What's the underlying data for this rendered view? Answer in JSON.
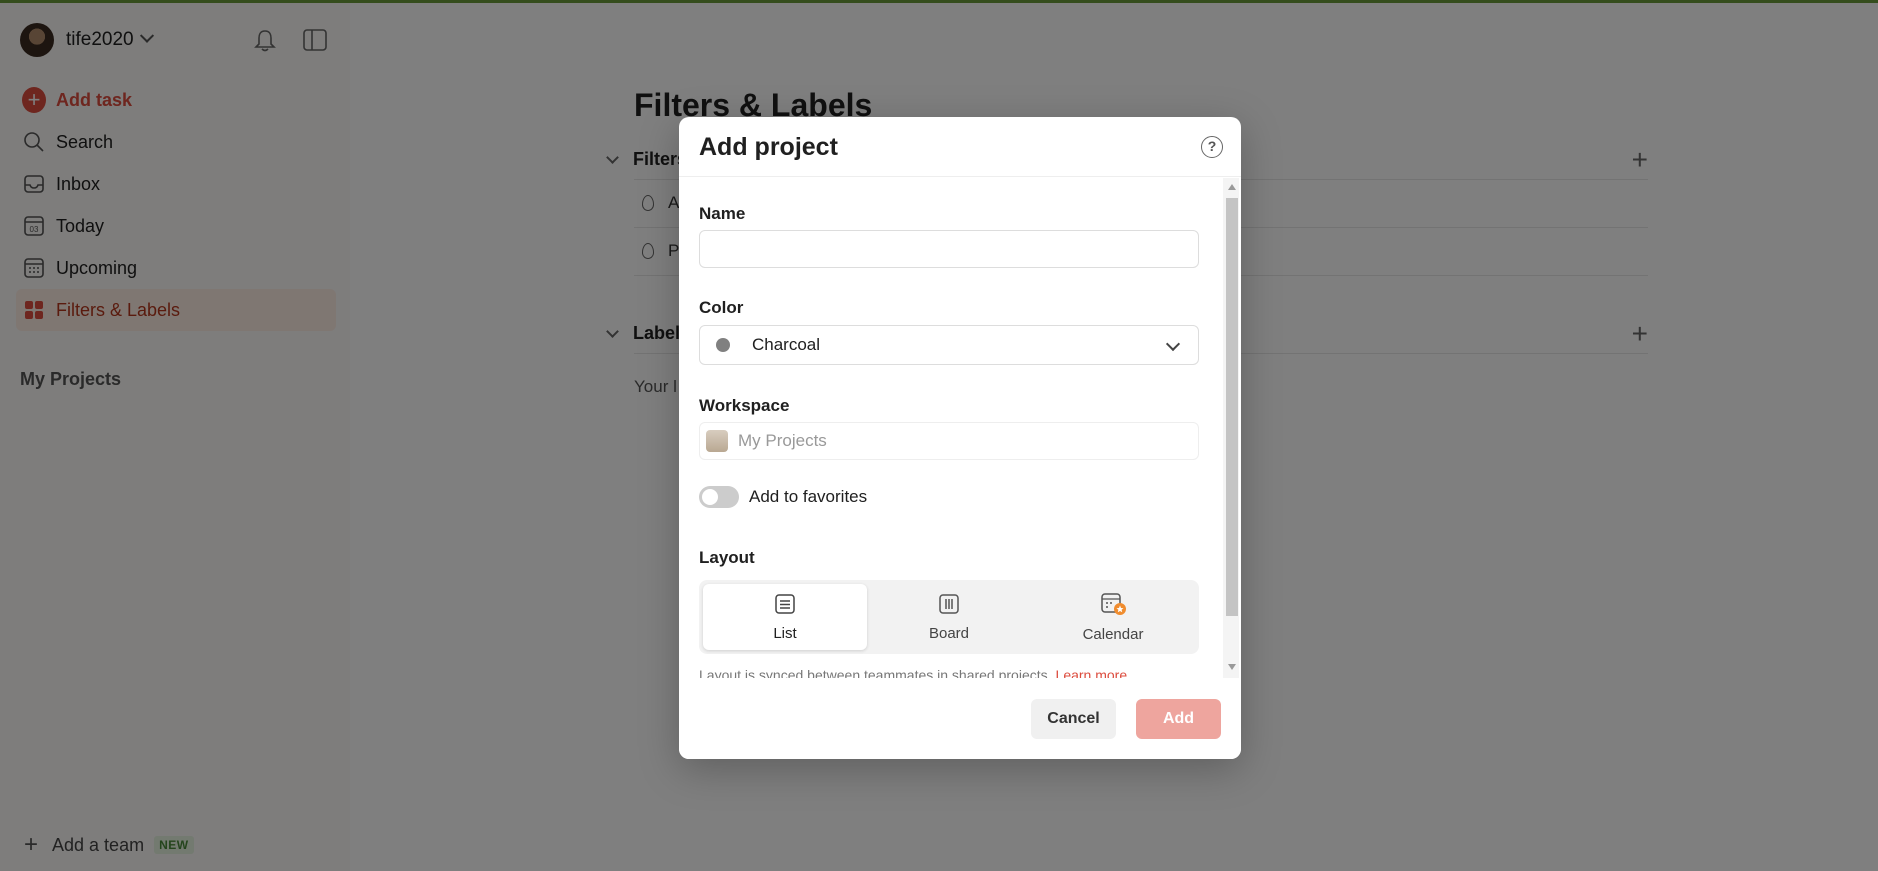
{
  "sidebar": {
    "username": "tife2020",
    "nav": [
      {
        "label": "Add task",
        "icon": "plus-circle-icon"
      },
      {
        "label": "Search",
        "icon": "search-icon"
      },
      {
        "label": "Inbox",
        "icon": "inbox-icon"
      },
      {
        "label": "Today",
        "icon": "calendar-today-icon",
        "day": "03"
      },
      {
        "label": "Upcoming",
        "icon": "calendar-grid-icon"
      },
      {
        "label": "Filters & Labels",
        "icon": "filters-grid-icon"
      }
    ],
    "my_projects": "My Projects",
    "add_team": "Add a team",
    "add_team_badge": "NEW"
  },
  "main": {
    "title": "Filters & Labels",
    "filters_section": "Filters",
    "filter_rows": [
      "A",
      "P"
    ],
    "labels_section": "Labels",
    "labels_empty": "Your l"
  },
  "modal": {
    "title": "Add project",
    "name_label": "Name",
    "name_value": "",
    "color_label": "Color",
    "color_value": "Charcoal",
    "color_hex": "#808080",
    "workspace_label": "Workspace",
    "workspace_value": "My Projects",
    "favorites_label": "Add to favorites",
    "favorites_on": false,
    "layout_label": "Layout",
    "layout_options": [
      "List",
      "Board",
      "Calendar"
    ],
    "layout_selected": "List",
    "layout_note": "Layout is synced between teammates in shared projects.",
    "learn_more": "Learn more",
    "cancel": "Cancel",
    "add": "Add"
  },
  "colors": {
    "accent": "#dc4c3e",
    "add_disabled": "#eea59e",
    "active_nav_bg": "#ffefe5"
  }
}
